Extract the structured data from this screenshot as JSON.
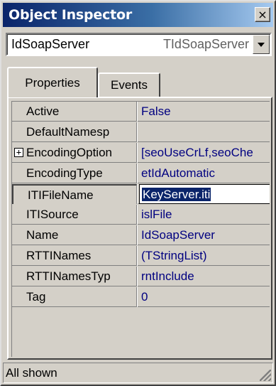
{
  "window": {
    "title": "Object Inspector",
    "close_icon": "close-icon",
    "close_glyph": "×"
  },
  "object_selector": {
    "name": "IdSoapServer",
    "class_name": "TIdSoapServer",
    "dropdown_icon": "chevron-down-icon"
  },
  "tabs": [
    {
      "label": "Properties",
      "active": true
    },
    {
      "label": "Events",
      "active": false
    }
  ],
  "properties": [
    {
      "name": "Active",
      "value": "False"
    },
    {
      "name": "DefaultNamesp",
      "value": ""
    },
    {
      "name": "EncodingOption",
      "value": "[seoUseCrLf,seoChe",
      "expandable": true,
      "expand_glyph": "+"
    },
    {
      "name": "EncodingType",
      "value": "etIdAutomatic"
    },
    {
      "name": "ITIFileName",
      "value": "KeyServer.iti",
      "selected": true
    },
    {
      "name": "ITISource",
      "value": "islFile"
    },
    {
      "name": "Name",
      "value": "IdSoapServer"
    },
    {
      "name": "RTTINames",
      "value": "(TStringList)"
    },
    {
      "name": "RTTINamesTyp",
      "value": "rntInclude"
    },
    {
      "name": "Tag",
      "value": "0"
    }
  ],
  "status": {
    "text": "All shown",
    "grip_icon": "size-grip-icon"
  },
  "colors": {
    "title_gradient_start": "#0a246a",
    "title_gradient_end": "#a6caf0",
    "value_text": "#000080",
    "face": "#d4d0c8",
    "selection": "#0a246a"
  }
}
